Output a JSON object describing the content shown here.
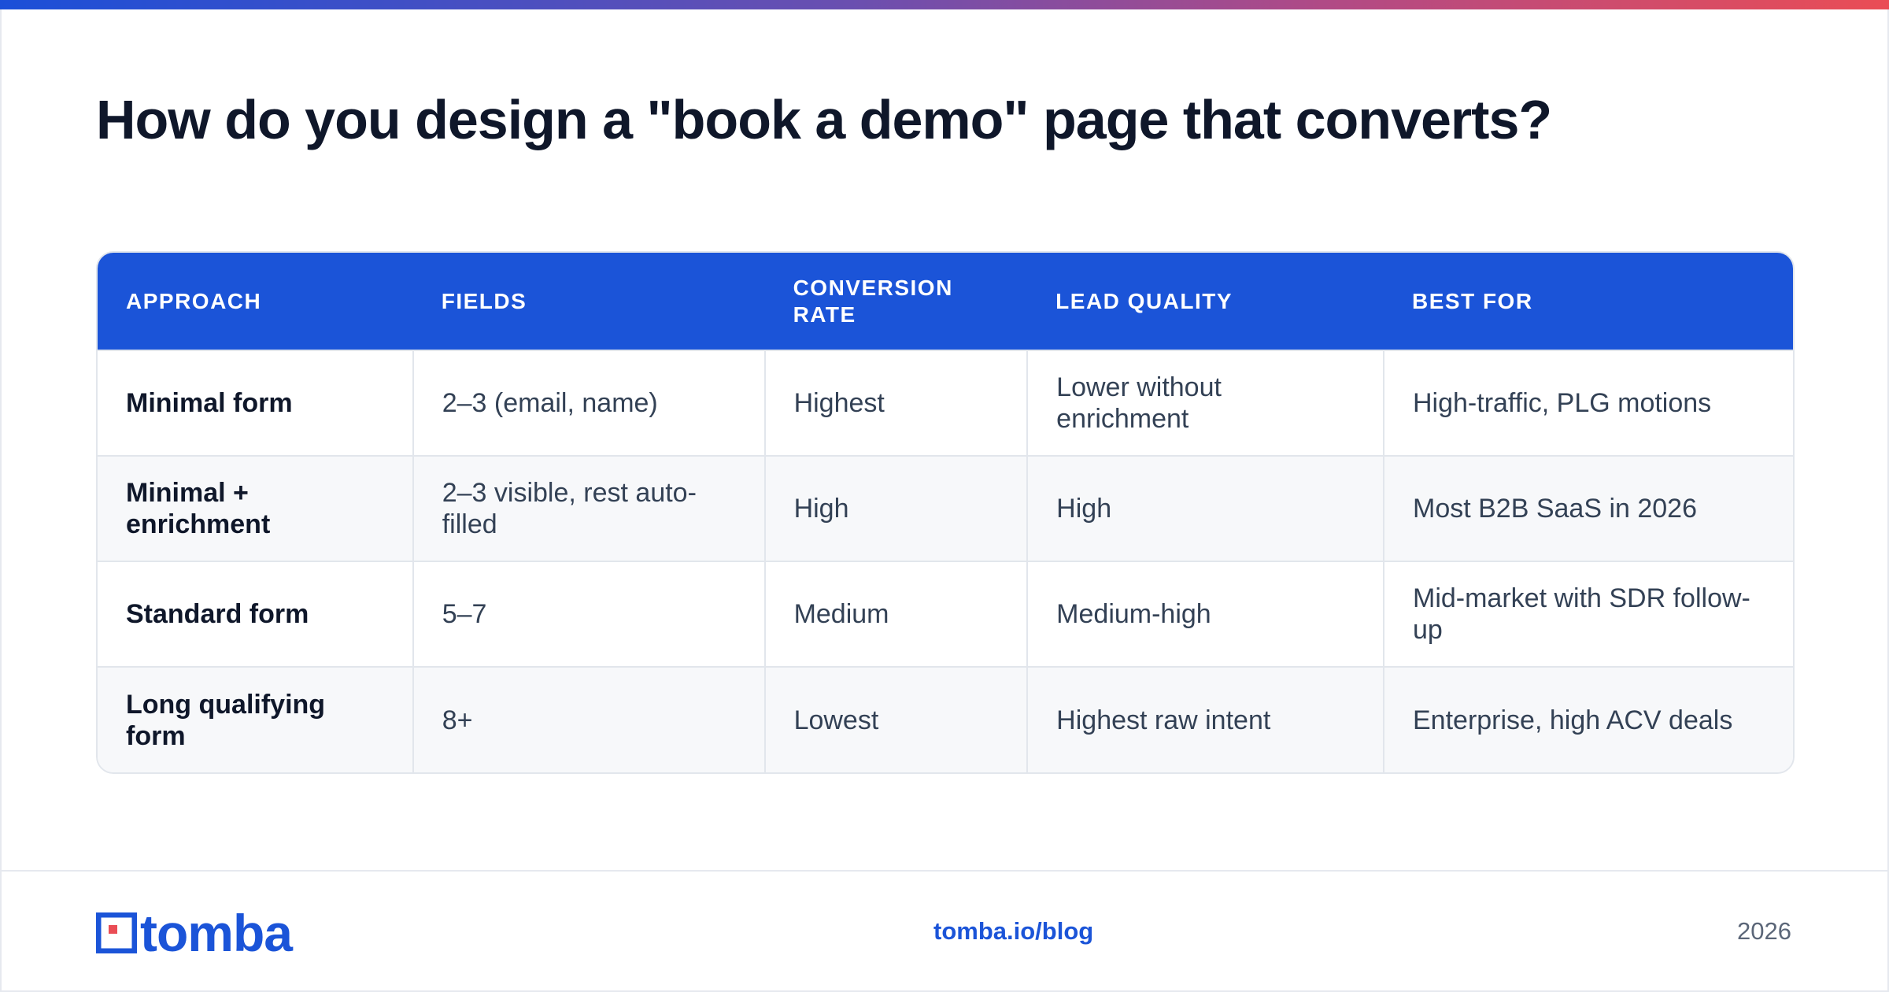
{
  "title": "How do you design a \"book a demo\" page that converts?",
  "table": {
    "headers": [
      "APPROACH",
      "FIELDS",
      "CONVERSION RATE",
      "LEAD QUALITY",
      "BEST FOR"
    ],
    "rows": [
      [
        "Minimal form",
        "2–3 (email, name)",
        "Highest",
        "Lower without enrichment",
        "High-traffic, PLG motions"
      ],
      [
        "Minimal + enrichment",
        "2–3 visible, rest auto-filled",
        "High",
        "High",
        "Most B2B SaaS in 2026"
      ],
      [
        "Standard form",
        "5–7",
        "Medium",
        "Medium-high",
        "Mid-market with SDR follow-up"
      ],
      [
        "Long qualifying form",
        "8+",
        "Lowest",
        "Highest raw intent",
        "Enterprise, high ACV deals"
      ]
    ]
  },
  "footer": {
    "logo_text": "tomba",
    "url": "tomba.io/blog",
    "year": "2026"
  },
  "colors": {
    "brand_blue": "#1b54d8",
    "brand_red": "#ea4d55",
    "title_text": "#0f172a",
    "body_text": "#334155"
  },
  "icons": {
    "logo": "tomba-logo-icon"
  }
}
